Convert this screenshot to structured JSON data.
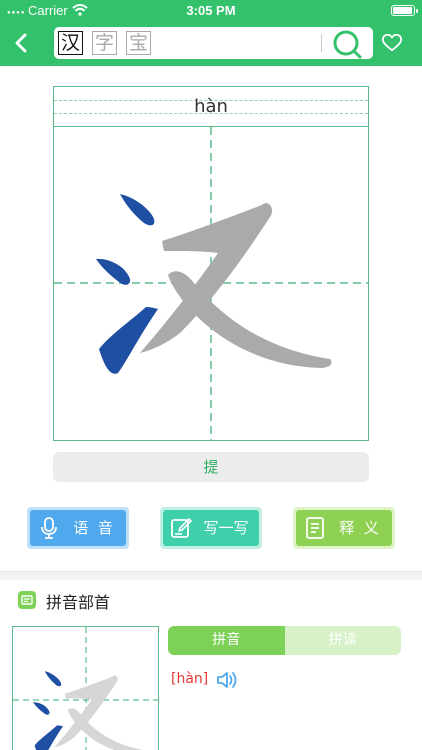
{
  "status_bar": {
    "carrier": "Carrier",
    "time": "3:05 PM"
  },
  "search": {
    "chars": [
      "汉",
      "字",
      "宝"
    ],
    "active_index": 0
  },
  "character": {
    "glyph": "汉",
    "pinyin": "hàn"
  },
  "hint_label": "提",
  "tools": [
    {
      "label": "语  音",
      "icon": "microphone-icon"
    },
    {
      "label": "写一写",
      "icon": "pencil-icon"
    },
    {
      "label": "释  义",
      "icon": "document-icon"
    }
  ],
  "section": {
    "title": "拼音部首",
    "icon": "book-icon"
  },
  "tabs": [
    {
      "label": "拼音",
      "active": true
    },
    {
      "label": "拼读",
      "active": false
    }
  ],
  "pronunciation": {
    "reading": "[hàn]"
  },
  "colors": {
    "header_green": "#33c26b",
    "stroke_blue": "#1f4fa3",
    "stroke_gray": "#aaaaaa",
    "voice_blue": "#4fa9ec",
    "write_teal": "#3fcfaa",
    "explain_green": "#8fd153",
    "reading_red": "#e53935"
  }
}
